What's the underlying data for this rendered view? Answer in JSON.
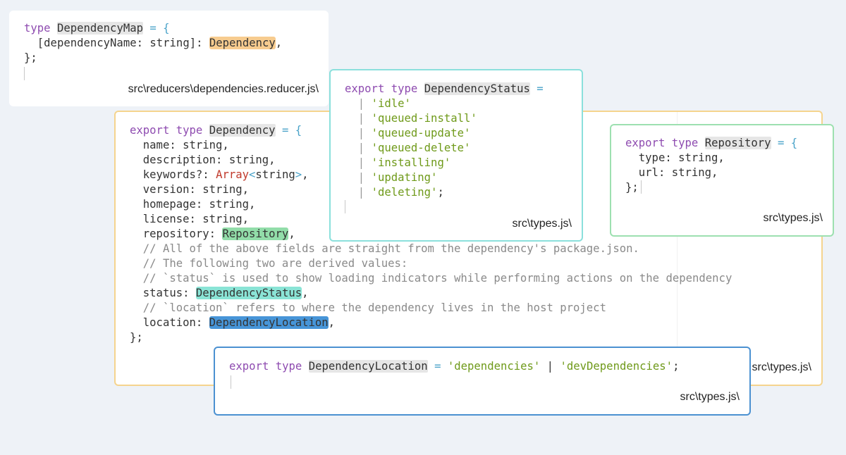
{
  "colors": {
    "background": "#eef2f7",
    "keyword": "#8e4bb0",
    "operator": "#4aa3c9",
    "string": "#6f9a1a",
    "comment": "#8a8a8a",
    "border_dependency": "#f5d48e",
    "border_status": "#8be0dc",
    "border_repository": "#9de0b0",
    "border_location": "#4b91d1",
    "highlight_dependency": "#f7cc8f",
    "highlight_repository": "#92dda9",
    "highlight_status": "#8ae4d6",
    "highlight_location": "#4795d8"
  },
  "map_card": {
    "kw_type": "type",
    "name": "DependencyMap",
    "eq_open": " = {",
    "index_sig": "  [dependencyName: string]: ",
    "value_type": "Dependency",
    "comma": ",",
    "close": "};",
    "file": "src\\reducers\\dependencies.reducer.js\\"
  },
  "dependency_card": {
    "kw_export": "export",
    "kw_type": "type",
    "name": "Dependency",
    "eq_open": " = {",
    "f_name": "  name: string,",
    "f_description": "  description: string,",
    "f_keywords_a": "  keywords?: ",
    "f_keywords_array": "Array",
    "f_keywords_lt": "<",
    "f_keywords_t": "string",
    "f_keywords_gt": ">",
    "f_keywords_c": ",",
    "f_version": "  version: string,",
    "f_homepage": "  homepage: string,",
    "f_license": "  license: string,",
    "f_repository_a": "  repository: ",
    "f_repository_t": "Repository",
    "comment1": "  // All of the above fields are straight from the dependency's package.json.",
    "comment2": "  // The following two are derived values:",
    "comment3": "  // `status` is used to show loading indicators while performing actions on the dependency",
    "f_status_a": "  status: ",
    "f_status_t": "DependencyStatus",
    "comment4": "  // `location` refers to where the dependency lives in the host project",
    "f_location_a": "  location: ",
    "f_location_t": "DependencyLocation",
    "close": "};",
    "file": "src\\types.js\\"
  },
  "status_card": {
    "kw_export": "export",
    "kw_type": "type",
    "name": "DependencyStatus",
    "eq": " =",
    "pipe": "  | ",
    "values": [
      "'idle'",
      "'queued-install'",
      "'queued-update'",
      "'queued-delete'",
      "'installing'",
      "'updating'",
      "'deleting'"
    ],
    "semicolon": ";",
    "file": "src\\types.js\\"
  },
  "repository_card": {
    "kw_export": "export",
    "kw_type": "type",
    "name": "Repository",
    "eq_open": " = {",
    "f_type": "  type: string,",
    "f_url": "  url: string,",
    "close": "};",
    "file": "src\\types.js\\"
  },
  "location_card": {
    "kw_export": "export",
    "kw_type": "type",
    "name": "DependencyLocation",
    "eq": " = ",
    "value1": "'dependencies'",
    "pipe": " | ",
    "value2": "'devDependencies'",
    "semicolon": ";",
    "file": "src\\types.js\\"
  }
}
